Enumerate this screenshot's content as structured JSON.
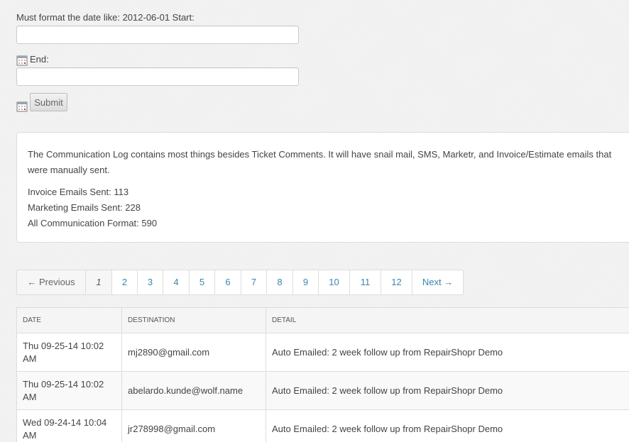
{
  "form": {
    "start_label": "Must format the date like: 2012-06-01 Start:",
    "end_label": "End:",
    "start_value": "",
    "end_value": "",
    "submit_label": "Submit"
  },
  "info": {
    "description": "The Communication Log contains most things besides Ticket Comments. It will have snail mail, SMS, Marketr, and Invoice/Estimate emails that were manually sent.",
    "invoice_emails": "Invoice Emails Sent: 113",
    "marketing_emails": "Marketing Emails Sent: 228",
    "all_communication": "All Communication Format: 590"
  },
  "pagination": {
    "previous": "← Previous",
    "next": "Next →",
    "pages": [
      "1",
      "2",
      "3",
      "4",
      "5",
      "6",
      "7",
      "8",
      "9",
      "10",
      "11",
      "12"
    ],
    "current": "1"
  },
  "table": {
    "headers": [
      "DATE",
      "DESTINATION",
      "DETAIL"
    ],
    "rows": [
      [
        "Thu 09-25-14 10:02 AM",
        "mj2890@gmail.com",
        "Auto Emailed: 2 week follow up from RepairShopr Demo"
      ],
      [
        "Thu 09-25-14 10:02 AM",
        "abelardo.kunde@wolf.name",
        "Auto Emailed: 2 week follow up from RepairShopr Demo"
      ],
      [
        "Wed 09-24-14 10:04 AM",
        "jr278998@gmail.com",
        "Auto Emailed: 2 week follow up from RepairShopr Demo"
      ]
    ]
  },
  "colors": {
    "link": "#3a87ad",
    "text": "#444444",
    "border": "#dddddd"
  },
  "icons": {
    "date_picker": "calendar-icon"
  }
}
